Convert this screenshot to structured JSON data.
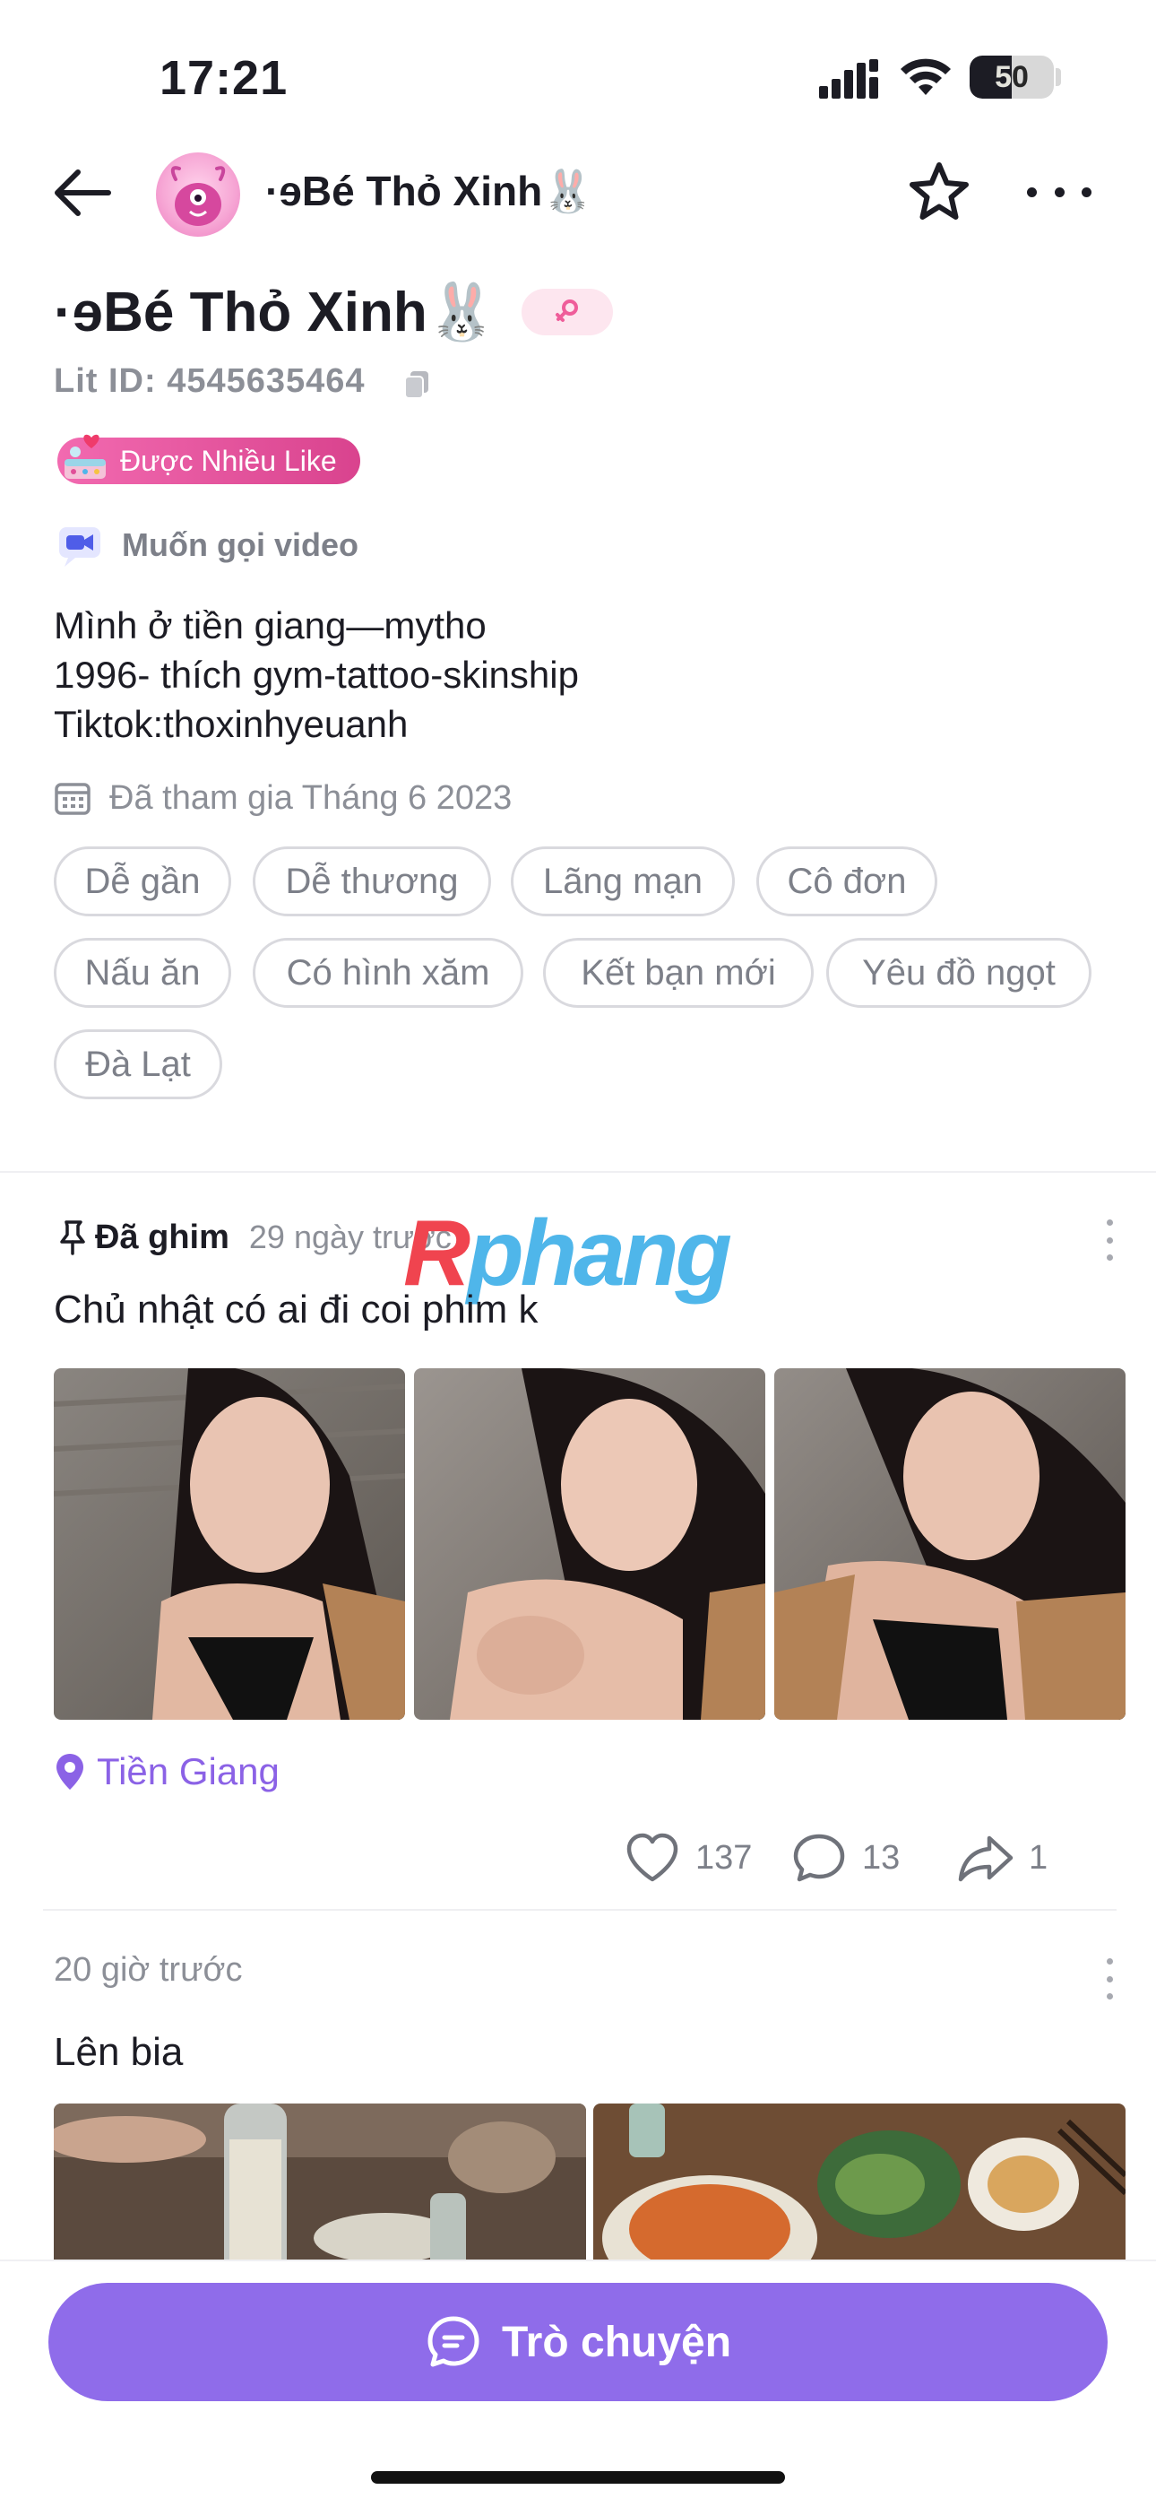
{
  "status_bar": {
    "time": "17:21",
    "battery_text": "50",
    "battery_level": 0.5
  },
  "header": {
    "name": "·ɘBé Thỏ Xinh🐰"
  },
  "profile": {
    "name": "·ɘBé Thỏ Xinh🐰",
    "gender_symbol": "♀",
    "lit_id": "Lit ID: 4545635464",
    "badge_label": "Được Nhiều Like",
    "video_label": "Muốn gọi video",
    "bio_lines": [
      "Mình ở tiền giang—mytho",
      "1996- thích gym-tattoo-skinship",
      "Tiktok:thoxinhyeuanh"
    ],
    "joined": "Đã tham gia Tháng 6 2023",
    "tags": [
      "Dễ gần",
      "Dễ thương",
      "Lãng mạn",
      "Cô đơn",
      "Nấu ăn",
      "Có hình xăm",
      "Kết bạn mới",
      "Yêu đồ ngọt",
      "Đà Lạt"
    ]
  },
  "watermark": {
    "first": "R",
    "rest": "phang"
  },
  "posts": [
    {
      "pinned_label": "Đã ghim",
      "time": "29 ngày trước",
      "text": "Chủ nhật có ai đi coi phim k",
      "location": "Tiền Giang",
      "likes": "137",
      "comments": "13",
      "shares": "1"
    },
    {
      "time": "20 giờ trước",
      "text": "Lên bia"
    }
  ],
  "bottom": {
    "chat_label": "Trò chuyện"
  },
  "colors": {
    "accent": "#8f6cea",
    "location": "#8b62e6",
    "badge": "#e04f98",
    "gender_bg": "#fde6ef"
  },
  "icons": [
    "signal-icon",
    "wifi-icon",
    "battery-icon",
    "back-arrow-icon",
    "star-icon",
    "more-icon",
    "female-icon",
    "copy-icon",
    "cake-icon",
    "video-camera-icon",
    "calendar-icon",
    "pin-icon",
    "location-pin-icon",
    "heart-icon",
    "comment-icon",
    "share-icon",
    "chat-bubble-icon"
  ]
}
